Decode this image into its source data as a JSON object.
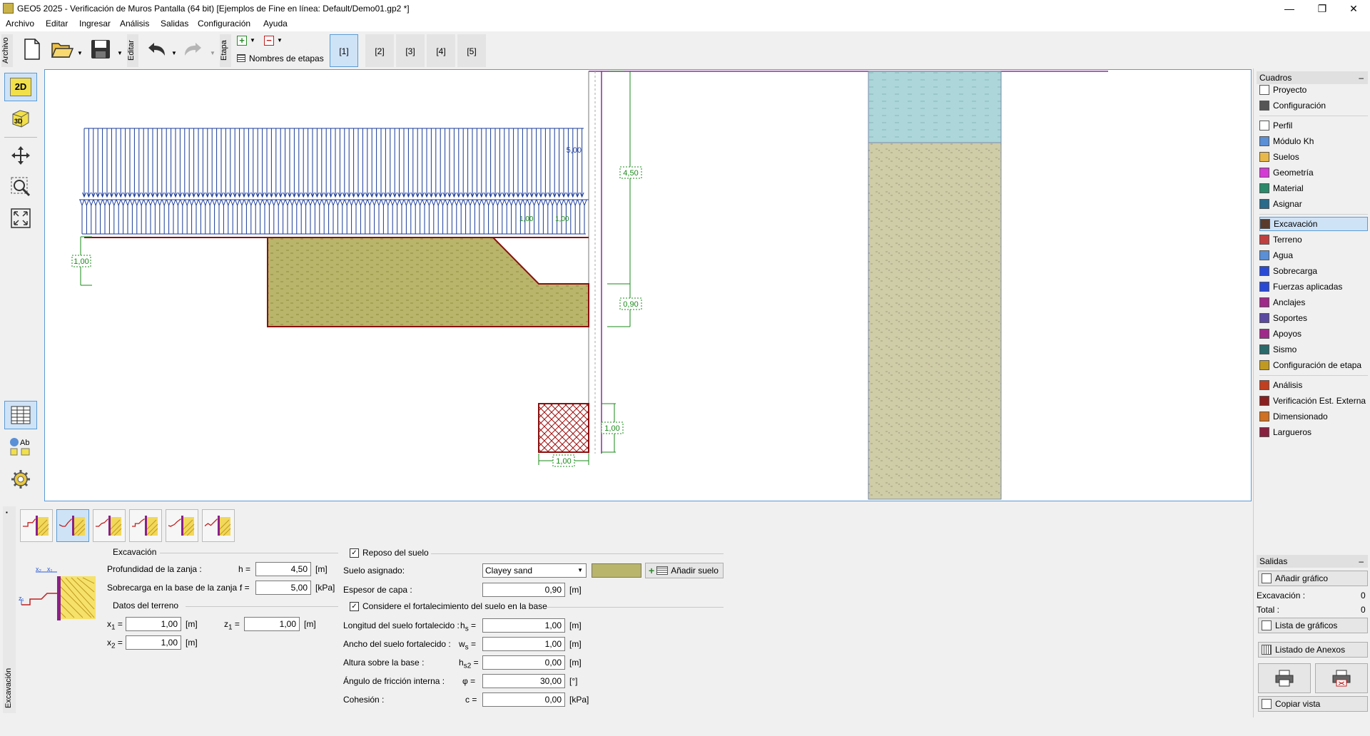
{
  "window": {
    "title": "GEO5 2025 - Verificación de Muros Pantalla (64 bit) [Ejemplos de Fine en línea: Default/Demo01.gp2 *]",
    "minimize": "—",
    "restore": "❐",
    "close": "✕"
  },
  "menu": [
    "Archivo",
    "Editar",
    "Ingresar",
    "Análisis",
    "Salidas",
    "Configuración",
    "Ayuda"
  ],
  "toolbar": {
    "archivo_label": "Archivo",
    "editar_label": "Editar",
    "etapa_label": "Etapa",
    "stage_names_label": "Nombres de etapas",
    "stages": [
      "[1]",
      "[2]",
      "[3]",
      "[4]",
      "[5]"
    ],
    "active_stage": 0
  },
  "lefttools": {
    "view_2d": "2D",
    "view_3d": "3D",
    "legend_ab": "Ab"
  },
  "drawing": {
    "surcharge_label": "5,00",
    "surcharge_small_labels": [
      "1,00",
      "1,00"
    ],
    "dim_left": "1,00",
    "dim_depth": "4,50",
    "dim_layer": "0,90",
    "dim_base_h": "1,00",
    "dim_base_w": "1,00",
    "colors": {
      "soil_fill": "#b9b56a",
      "soil_border": "#8a1010",
      "surcharge": "#1a3a9a",
      "dimension": "#1a8a1a",
      "water": "#acd6d9",
      "profile_soil": "#cfcca8"
    }
  },
  "right_panel": {
    "header": "Cuadros",
    "group1": [
      {
        "label": "Proyecto",
        "icon": "document-icon"
      },
      {
        "label": "Configuración",
        "icon": "gear-icon"
      }
    ],
    "group2": [
      {
        "label": "Perfil",
        "icon": "profile-icon"
      },
      {
        "label": "Módulo Kh",
        "icon": "modulus-icon"
      },
      {
        "label": "Suelos",
        "icon": "soils-icon"
      },
      {
        "label": "Geometría",
        "icon": "geometry-icon"
      },
      {
        "label": "Material",
        "icon": "material-icon"
      },
      {
        "label": "Asignar",
        "icon": "assign-icon"
      }
    ],
    "group3": [
      {
        "label": "Excavación",
        "icon": "excavation-icon",
        "active": true
      },
      {
        "label": "Terreno",
        "icon": "terrain-icon"
      },
      {
        "label": "Agua",
        "icon": "water-icon"
      },
      {
        "label": "Sobrecarga",
        "icon": "surcharge-icon"
      },
      {
        "label": "Fuerzas aplicadas",
        "icon": "forces-icon"
      },
      {
        "label": "Anclajes",
        "icon": "anchors-icon"
      },
      {
        "label": "Soportes",
        "icon": "props-icon"
      },
      {
        "label": "Apoyos",
        "icon": "supports-icon"
      },
      {
        "label": "Sismo",
        "icon": "earthquake-icon"
      },
      {
        "label": "Configuración de etapa",
        "icon": "stage-settings-icon"
      }
    ],
    "group4": [
      {
        "label": "Análisis",
        "icon": "analysis-icon"
      },
      {
        "label": "Verificación Est. Externa",
        "icon": "external-stability-icon"
      },
      {
        "label": "Dimensionado",
        "icon": "dimensioning-icon"
      },
      {
        "label": "Largueros",
        "icon": "walers-icon"
      }
    ],
    "outputs_header": "Salidas",
    "add_graph": "Añadir gráfico",
    "excavacion_label": "Excavación :",
    "excavacion_count": "0",
    "total_label": "Total :",
    "total_count": "0",
    "graph_list": "Lista de gráficos",
    "annex_list": "Listado de Anexos",
    "copy_view": "Copiar vista"
  },
  "bottom": {
    "side_label": "Excavación",
    "excavacion_group": "Excavación",
    "depth_label": "Profundidad de la zanja :",
    "depth_sym": "h =",
    "depth_value": "4,50",
    "depth_unit": "[m]",
    "surch_label": "Sobrecarga en la base de la zanja :",
    "surch_sym": "f =",
    "surch_value": "5,00",
    "surch_unit": "[kPa]",
    "terrain_group": "Datos del terreno",
    "x1_sym": "x",
    "x1_sub": "1",
    "x1_value": "1,00",
    "x1_unit": "[m]",
    "z1_sym": "z",
    "z1_sub": "1",
    "z1_value": "1,00",
    "z1_unit": "[m]",
    "x2_sym": "x",
    "x2_sub": "2",
    "x2_value": "1,00",
    "x2_unit": "[m]",
    "reposo_label": "Reposo del suelo",
    "suelo_asignado_label": "Suelo asignado:",
    "suelo_value": "Clayey sand",
    "add_soil": "Añadir suelo",
    "espesor_label": "Espesor de capa :",
    "espesor_value": "0,90",
    "espesor_unit": "[m]",
    "fort_label": "Considere el fortalecimiento del suelo en la base",
    "long_label": "Longitud del suelo fortalecido :",
    "long_sym": "h",
    "long_sub": "s",
    "long_value": "1,00",
    "long_unit": "[m]",
    "ancho_label": "Ancho del suelo fortalecido :",
    "ancho_sym": "w",
    "ancho_sub": "s",
    "ancho_value": "1,00",
    "ancho_unit": "[m]",
    "altura_label": "Altura sobre la base :",
    "altura_sym": "h",
    "altura_sub": "s2",
    "altura_value": "0,00",
    "altura_unit": "[m]",
    "angulo_label": "Ángulo de fricción interna :",
    "angulo_sym": "φ =",
    "angulo_value": "30,00",
    "angulo_unit": "[°]",
    "cohesion_label": "Cohesión :",
    "cohesion_sym": "c =",
    "cohesion_value": "0,00",
    "cohesion_unit": "[kPa]",
    "sketch_x2": "x₂",
    "sketch_x1": "x₁",
    "sketch_z1": "z₁"
  }
}
